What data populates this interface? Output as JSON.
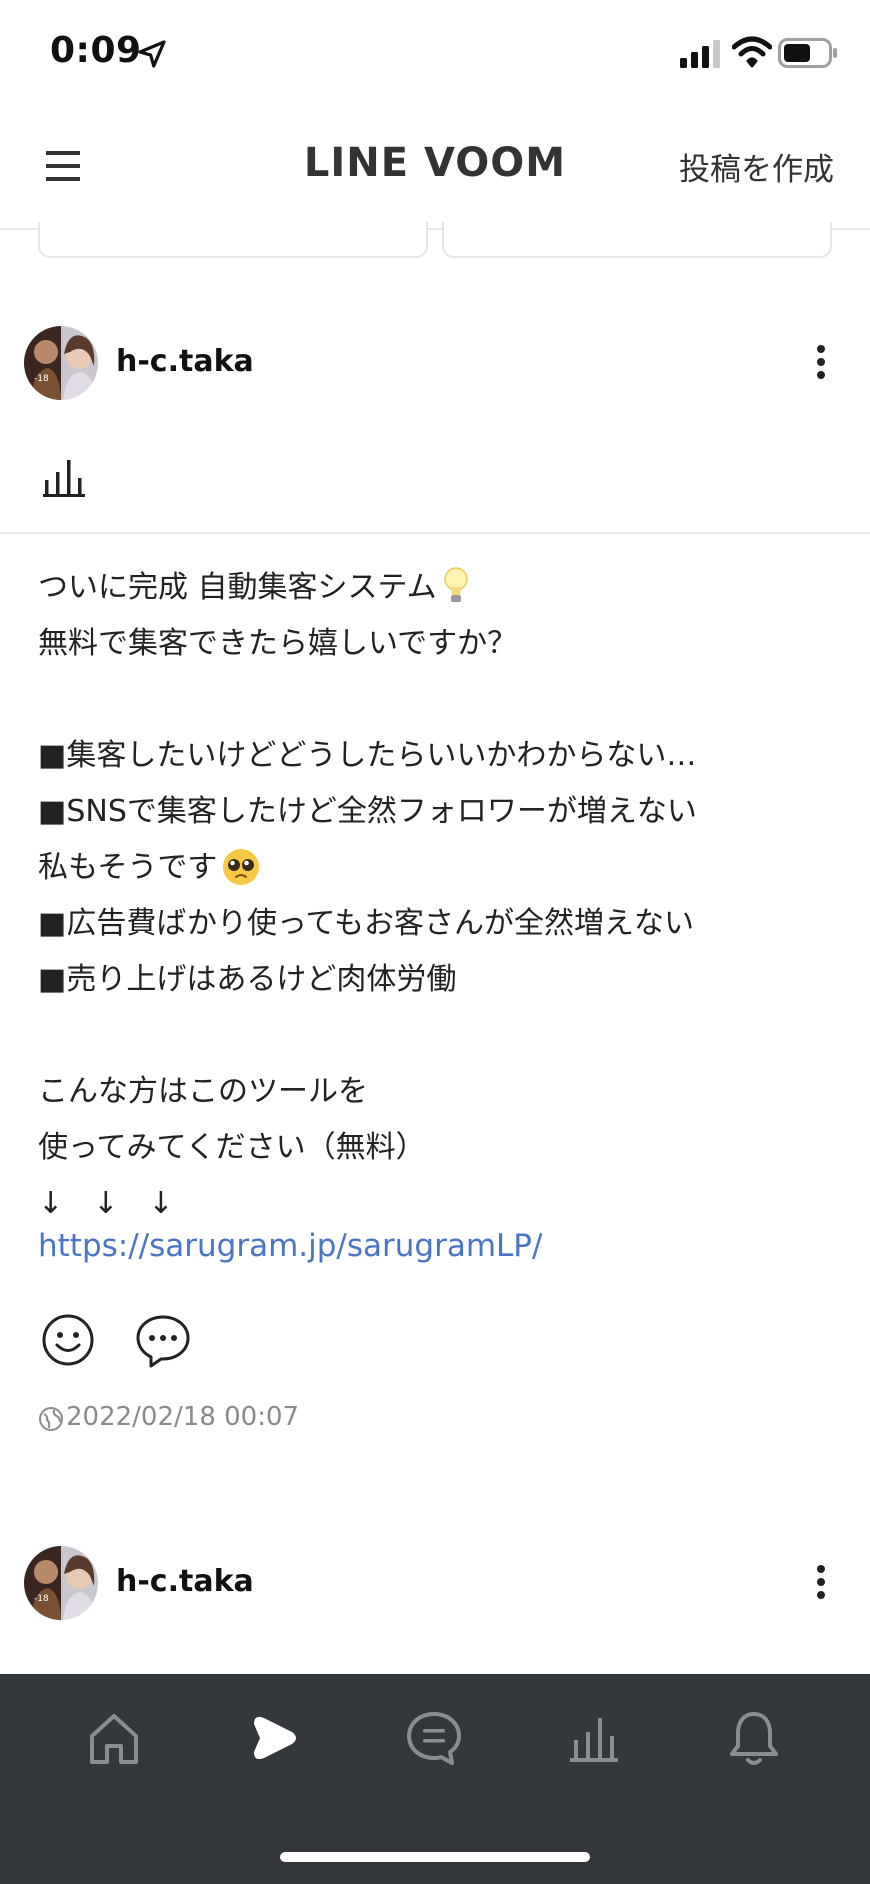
{
  "status_bar": {
    "time": "0:09",
    "icons": [
      "location-arrow-icon",
      "signal-icon",
      "wifi-icon",
      "battery-icon"
    ]
  },
  "header": {
    "menu_icon": "hamburger-menu-icon",
    "title": "LINE VOOM",
    "create_post": "投稿を作成"
  },
  "post": {
    "author": "h-c.taka",
    "text_lines": [
      "ついに完成 自動集客システム",
      "無料で集客できたら嬉しいですか？",
      "",
      "■集客したいけどどうしたらいいかわからない…",
      "■SNSで集客したけど全然フォロワーが増えない",
      "私もそうです",
      "■広告費ばかり使ってもお客さんが全然増えない",
      "■売り上げはあるけど肉体労働",
      "",
      "こんな方はこのツールを",
      "使ってみてください（無料）",
      "↓　↓　↓"
    ],
    "link": "https://sarugram.jp/sarugramLP/",
    "date": "2022/02/18 00:07",
    "emojis": [
      "lightbulb-icon",
      "pleading-face-icon"
    ]
  },
  "next_post": {
    "author": "h-c.taka"
  },
  "bottom_nav": {
    "items": [
      "home-icon",
      "voom-play-icon",
      "chat-icon",
      "stats-icon",
      "bell-icon"
    ],
    "active_index": 1
  },
  "colors": {
    "link": "#4a74c8",
    "nav_background": "#34373b",
    "nav_active": "#ffffff",
    "nav_inactive": "#8a8d91"
  }
}
